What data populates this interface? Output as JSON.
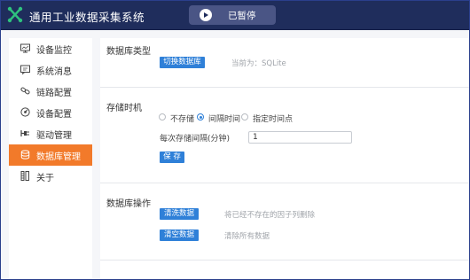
{
  "header": {
    "title": "通用工业数据采集系统",
    "status_label": "已暂停",
    "colors": {
      "bar": "#1f2d5c",
      "pill": "#4a5585"
    }
  },
  "sidebar": {
    "items": [
      {
        "label": "设备监控",
        "icon": "monitor-icon"
      },
      {
        "label": "系统消息",
        "icon": "message-icon"
      },
      {
        "label": "链路配置",
        "icon": "link-icon"
      },
      {
        "label": "设备配置",
        "icon": "settings-dial-icon"
      },
      {
        "label": "驱动管理",
        "icon": "driver-icon"
      },
      {
        "label": "数据库管理",
        "icon": "database-icon",
        "active": true
      },
      {
        "label": "关于",
        "icon": "about-icon"
      }
    ],
    "active_color": "#f27a2a"
  },
  "main": {
    "db_type": {
      "title": "数据库类型",
      "switch_button": "切换数据库",
      "current_hint": "当前为：SQLite"
    },
    "storage": {
      "title": "存储时机",
      "options": [
        "不存储",
        "间隔时间",
        "指定时间点"
      ],
      "selected_option": "间隔时间",
      "interval_label": "每次存储间隔(分钟)",
      "interval_value": "1",
      "save_button": "保 存"
    },
    "operations": {
      "title": "数据库操作",
      "clean_button": "清洗数据",
      "clean_hint": "将已经不存在的因子列删除",
      "clear_button": "清空数据",
      "clear_hint": "清除所有数据"
    },
    "accent_color": "#2f80d8"
  }
}
